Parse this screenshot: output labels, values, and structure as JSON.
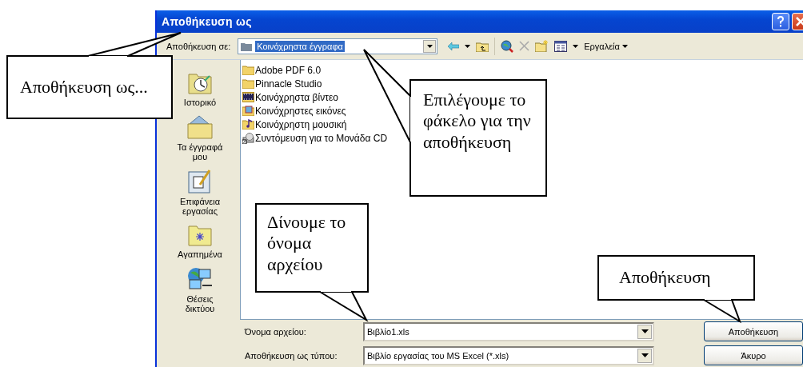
{
  "window": {
    "title": "Αποθήκευση ως"
  },
  "toolbar": {
    "save_in_label": "Αποθήκευση σε:",
    "location": "Κοινόχρηστα έγγραφα",
    "location_selected": true,
    "tools_label": "Εργαλεία"
  },
  "places": [
    {
      "label": "Ιστορικό",
      "kind": "history"
    },
    {
      "label": "Τα έγγραφά μου",
      "kind": "documents"
    },
    {
      "label": "Επιφάνεια εργασίας",
      "kind": "desktop"
    },
    {
      "label": "Αγαπημένα",
      "kind": "favorites"
    },
    {
      "label": "Θέσεις δικτύου",
      "kind": "network"
    }
  ],
  "files": [
    {
      "name": "Adobe PDF 6.0",
      "kind": "folder"
    },
    {
      "name": "Pinnacle Studio",
      "kind": "folder"
    },
    {
      "name": "Κοινόχρηστα βίντεο",
      "kind": "video"
    },
    {
      "name": "Κοινόχρηστες εικόνες",
      "kind": "pictures"
    },
    {
      "name": "Κοινόχρηστη μουσική",
      "kind": "music"
    },
    {
      "name": "Συντόμευση για το Μονάδα CD",
      "kind": "shortcut"
    }
  ],
  "file_name": {
    "label": "Όνομα αρχείου:",
    "value": "Βιβλίο1.xls"
  },
  "file_type": {
    "label": "Αποθήκευση ως τύπου:",
    "value": "Βιβλίο εργασίας του MS Excel (*.xls)"
  },
  "buttons": [
    "Αποθήκευση",
    "Άκυρο"
  ],
  "callouts": [
    {
      "text": "Αποθήκευση ως..."
    },
    {
      "text": "Επιλέγουμε το φάκελο για την αποθήκευση"
    },
    {
      "text": "Δίνουμε το όνομα αρχείου"
    },
    {
      "text": "Αποθήκευση"
    }
  ]
}
